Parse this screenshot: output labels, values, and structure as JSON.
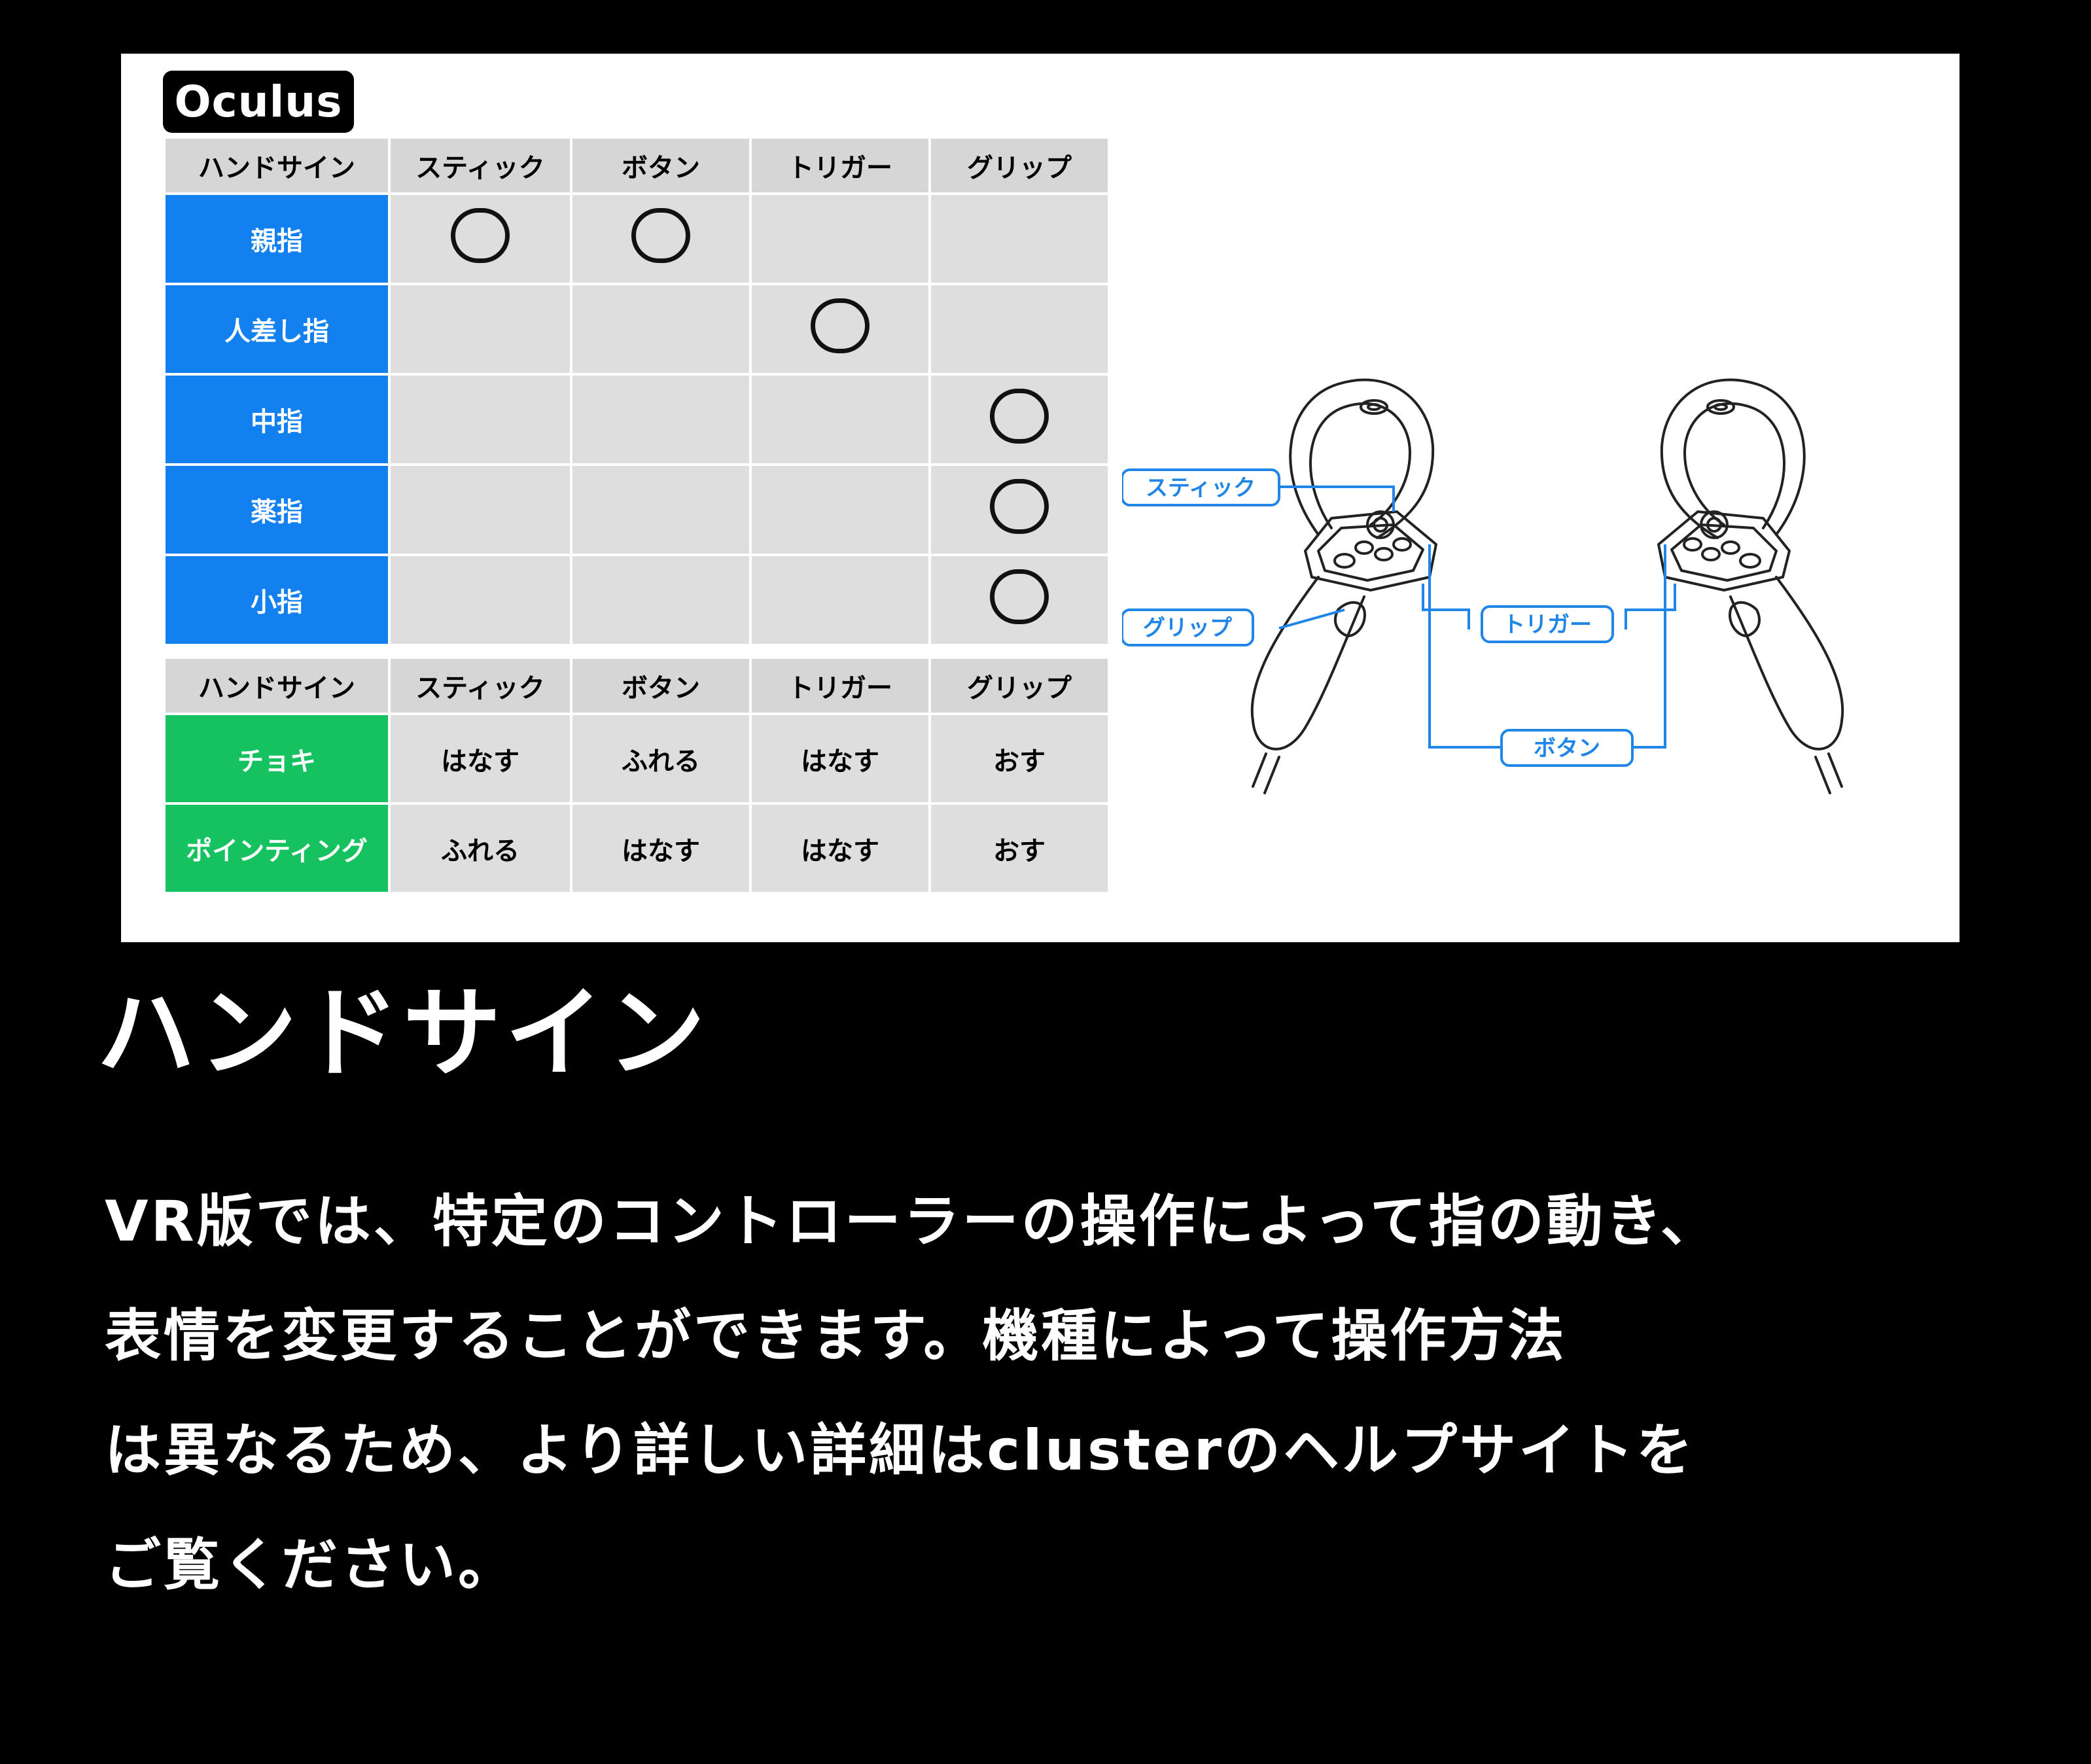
{
  "panel": {
    "badge": "Oculus",
    "columns": [
      "ハンドサイン",
      "スティック",
      "ボタン",
      "トリガー",
      "グリップ"
    ],
    "finger_table": [
      {
        "label": "親指",
        "stick": true,
        "button": true,
        "trigger": false,
        "grip": false
      },
      {
        "label": "人差し指",
        "stick": false,
        "button": false,
        "trigger": true,
        "grip": false
      },
      {
        "label": "中指",
        "stick": false,
        "button": false,
        "trigger": false,
        "grip": true
      },
      {
        "label": "薬指",
        "stick": false,
        "button": false,
        "trigger": false,
        "grip": true
      },
      {
        "label": "小指",
        "stick": false,
        "button": false,
        "trigger": false,
        "grip": true
      }
    ],
    "sign_table": [
      {
        "label": "チョキ",
        "stick": "はなす",
        "button": "ふれる",
        "trigger": "はなす",
        "grip": "おす"
      },
      {
        "label": "ポインティング",
        "stick": "ふれる",
        "button": "はなす",
        "trigger": "はなす",
        "grip": "おす"
      }
    ],
    "diagram": {
      "labels": {
        "stick": "スティック",
        "grip": "グリップ",
        "trigger": "トリガー",
        "button": "ボタン"
      },
      "accent_color": "#1f86e8"
    }
  },
  "heading": "ハンドサイン",
  "body_lines": [
    "VR版では、特定のコントローラーの操作によって指の動き、",
    "表情を変更することができます。機種によって操作方法",
    "は異なるため、より詳しい詳細はclusterのヘルプサイトを",
    "ご覧ください。"
  ]
}
